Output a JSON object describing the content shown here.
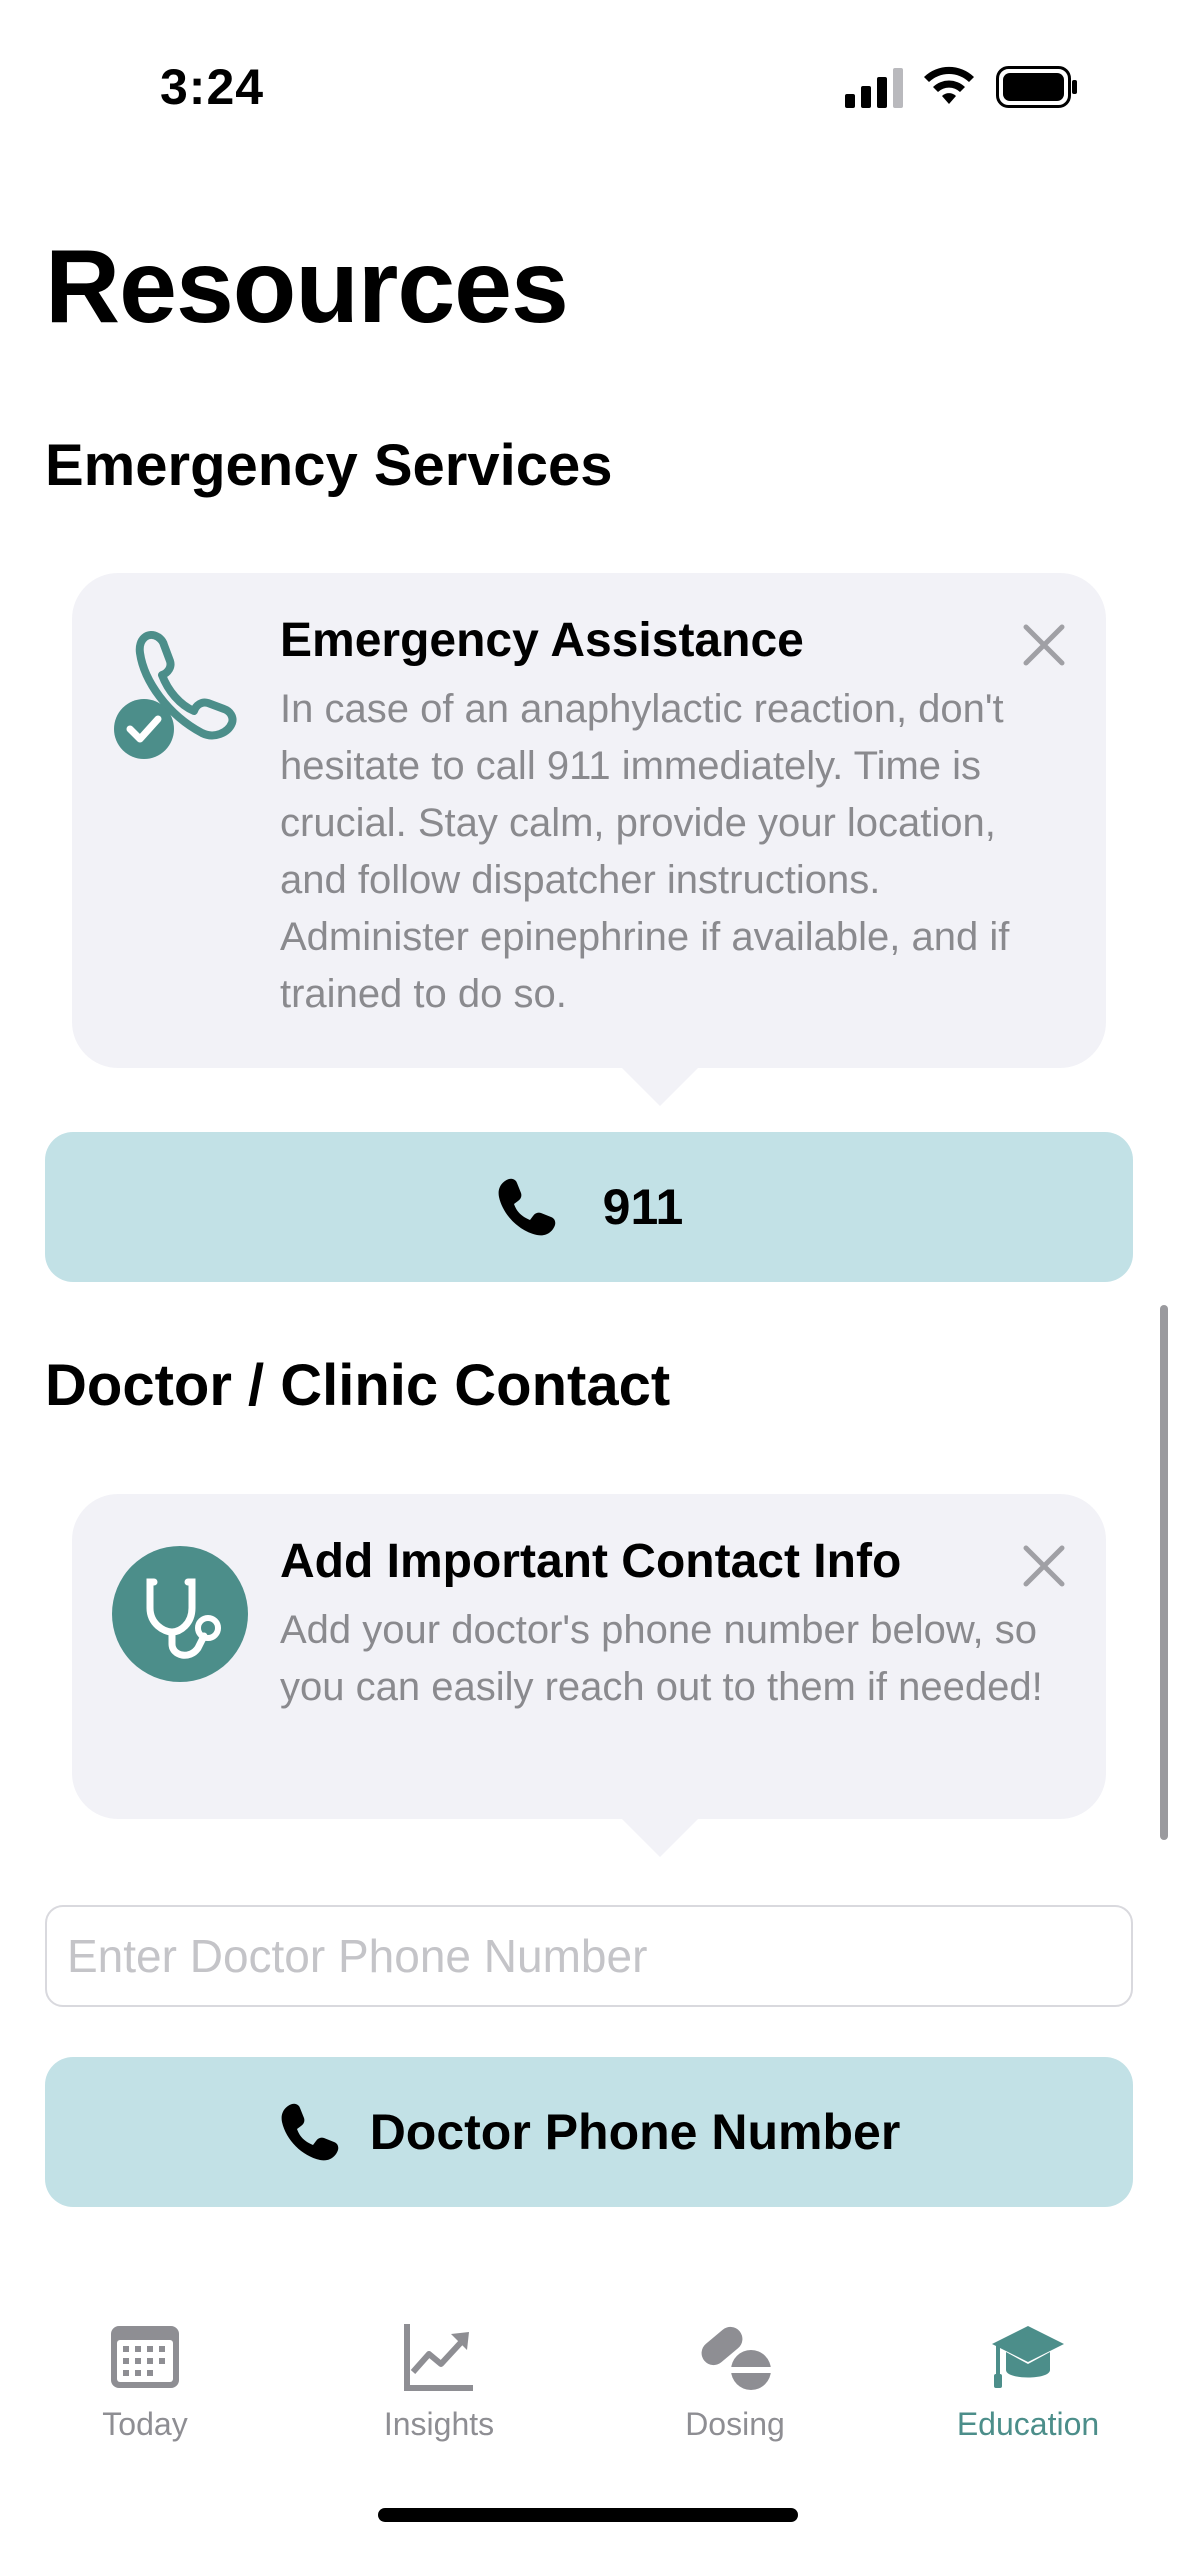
{
  "status_bar": {
    "time": "3:24"
  },
  "page": {
    "title": "Resources"
  },
  "emergency": {
    "heading": "Emergency Services",
    "tip_title": "Emergency Assistance",
    "tip_body": "In case of an anaphylactic reaction, don't hesitate to call 911 immediately. Time is crucial. Stay calm, provide your location, and follow dispatcher instructions. Administer epinephrine if available, and if trained to do so.",
    "tip_icon": "phone-check-icon",
    "call_label": "911"
  },
  "doctor": {
    "heading": "Doctor / Clinic Contact",
    "tip_title": "Add Important Contact Info",
    "tip_body": "Add your doctor's phone number below, so you can easily reach out to them if needed!",
    "tip_icon": "stethoscope-icon",
    "input_placeholder": "Enter Doctor Phone Number",
    "input_value": "",
    "call_label": "Doctor Phone Number"
  },
  "tabs": [
    {
      "label": "Today",
      "icon": "calendar-icon",
      "active": false
    },
    {
      "label": "Insights",
      "icon": "chart-icon",
      "active": false
    },
    {
      "label": "Dosing",
      "icon": "pills-icon",
      "active": false
    },
    {
      "label": "Education",
      "icon": "graduation-cap-icon",
      "active": true
    }
  ],
  "colors": {
    "accent": "#4c8e8a",
    "button_bg": "#c2e1e6",
    "card_bg": "#f2f2f7",
    "inactive": "#8e8e93"
  }
}
